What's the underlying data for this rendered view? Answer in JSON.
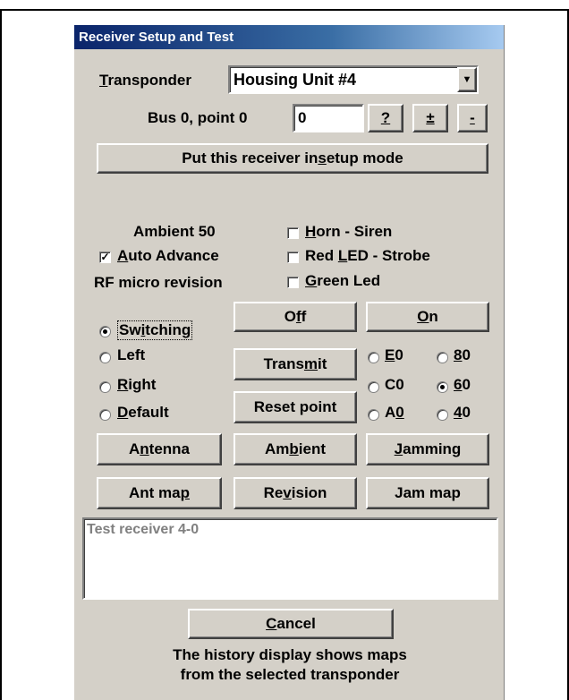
{
  "dialog": {
    "title": "Receiver Setup and Test",
    "transponder": {
      "label_prefix": "",
      "label_u": "T",
      "label_rest": "ransponder",
      "value": "Housing Unit #4"
    },
    "bus_point": {
      "label": "Bus 0, point 0",
      "value": "0"
    },
    "small_buttons": [
      "?",
      "±",
      "-"
    ],
    "setup_button": {
      "pre": "Put this receiver in ",
      "u": "s",
      "post": "etup mode"
    },
    "ambient_label": "Ambient 50",
    "auto_advance": {
      "pre": "",
      "u": "A",
      "post": "uto Advance",
      "checked": true
    },
    "rf_label": "RF micro revision",
    "options": [
      {
        "pre": "",
        "u": "H",
        "post": "orn - Siren",
        "checked": false
      },
      {
        "pre": "Red ",
        "u": "L",
        "post": "ED - Strobe",
        "checked": false
      },
      {
        "pre": "",
        "u": "G",
        "post": "reen Led",
        "checked": false
      }
    ],
    "mode_radios": [
      {
        "pre": "Sw",
        "u": "i",
        "post": "tching",
        "selected": true
      },
      {
        "pre": "Left",
        "u": "",
        "post": "",
        "selected": false
      },
      {
        "pre": "",
        "u": "R",
        "post": "ight",
        "selected": false
      },
      {
        "pre": "",
        "u": "D",
        "post": "efault",
        "selected": false
      }
    ],
    "off_button": {
      "pre": "O",
      "u": "f",
      "post": "f"
    },
    "on_button": {
      "pre": "",
      "u": "O",
      "post": "n"
    },
    "transmit_button": {
      "pre": "Trans",
      "u": "m",
      "post": "it"
    },
    "reset_button": {
      "pre": "Reset point",
      "u": "",
      "post": ""
    },
    "level_radios": [
      {
        "pre": "",
        "u": "E",
        "post": "0",
        "selected": false
      },
      {
        "pre": "",
        "u": "8",
        "post": "0",
        "selected": false
      },
      {
        "pre": "C0",
        "u": "",
        "post": "",
        "selected": false
      },
      {
        "pre": "",
        "u": "6",
        "post": "0",
        "selected": true
      },
      {
        "pre": "A",
        "u": "0",
        "post": "",
        "selected": false
      },
      {
        "pre": "",
        "u": "4",
        "post": "0",
        "selected": false
      }
    ],
    "row_buttons_1": [
      {
        "pre": "A",
        "u": "n",
        "post": "tenna"
      },
      {
        "pre": "Am",
        "u": "b",
        "post": "ient"
      },
      {
        "pre": "",
        "u": "J",
        "post": "amming"
      }
    ],
    "row_buttons_2": [
      {
        "pre": "Ant ma",
        "u": "p",
        "post": ""
      },
      {
        "pre": "Re",
        "u": "v",
        "post": "ision"
      },
      {
        "pre": "Jam map",
        "u": "",
        "post": ""
      }
    ],
    "history_text": "Test receiver 4-0",
    "cancel_button": {
      "pre": "",
      "u": "C",
      "post": "ancel"
    },
    "footer_line1": "The history display shows maps",
    "footer_line2": "from the selected transponder"
  }
}
